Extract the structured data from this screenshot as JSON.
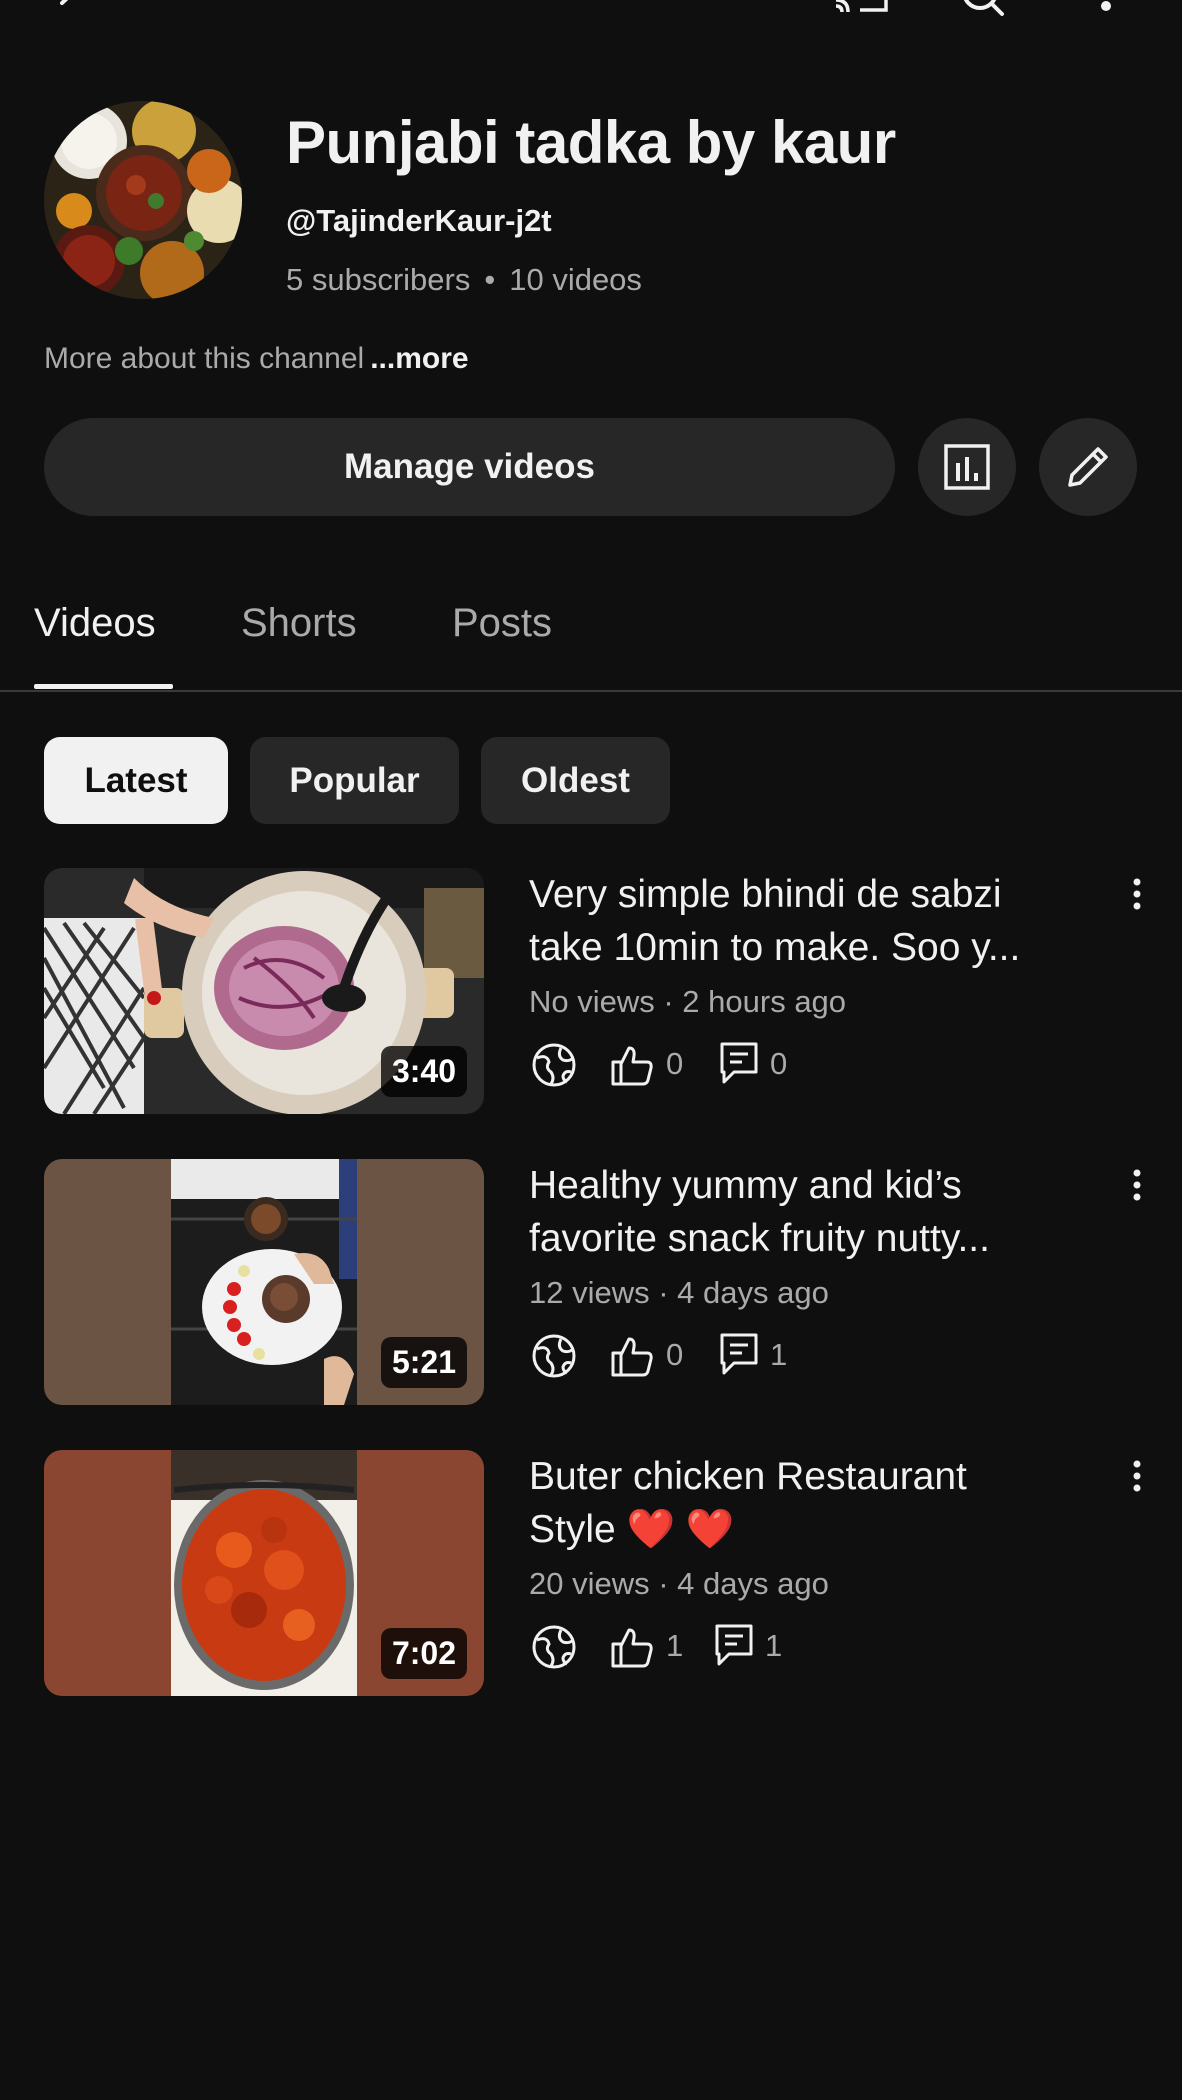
{
  "channel": {
    "name": "Punjabi tadka by kaur",
    "handle": "@TajinderKaur-j2t",
    "subscribers": "5 subscribers",
    "videos_count": "10 videos",
    "separator": "•",
    "about": "More about this channel",
    "more": "...more"
  },
  "actions": {
    "manage_videos": "Manage videos"
  },
  "tabs": [
    {
      "label": "Videos",
      "active": true
    },
    {
      "label": "Shorts",
      "active": false
    },
    {
      "label": "Posts",
      "active": false
    }
  ],
  "chips": [
    {
      "label": "Latest",
      "selected": true
    },
    {
      "label": "Popular",
      "selected": false
    },
    {
      "label": "Oldest",
      "selected": false
    }
  ],
  "videos": [
    {
      "title_line1": "Very simple bhindi de sabzi",
      "title_line2": "take 10min to make. Soo y...",
      "meta": "No views · 2 hours ago",
      "duration": "3:40",
      "likes": "0",
      "comments": "0"
    },
    {
      "title_line1": "Healthy yummy and kid’s",
      "title_line2": "favorite snack fruity nutty...",
      "meta": "12 views · 4 days ago",
      "duration": "5:21",
      "likes": "0",
      "comments": "1"
    },
    {
      "title_line1": "Buter chicken Restaurant",
      "title_line2": "Style ❤️ ❤️",
      "meta": "20 views · 4 days ago",
      "duration": "7:02",
      "likes": "1",
      "comments": "1"
    }
  ],
  "icons": {
    "top_left": "back-arrow-icon",
    "top_right": [
      "cast-icon",
      "search-icon",
      "more-vert-icon"
    ],
    "analytics": "analytics-icon",
    "edit": "pencil-icon",
    "visibility": "public-globe-icon",
    "like": "thumbs-up-icon",
    "comment": "comment-icon",
    "video_menu": "more-vert-icon"
  },
  "colors": {
    "background": "#0f0f0f",
    "surface": "#272727",
    "text_primary": "#f1f1f1",
    "text_secondary": "#aaaaaa",
    "heart": "#e0202b"
  }
}
